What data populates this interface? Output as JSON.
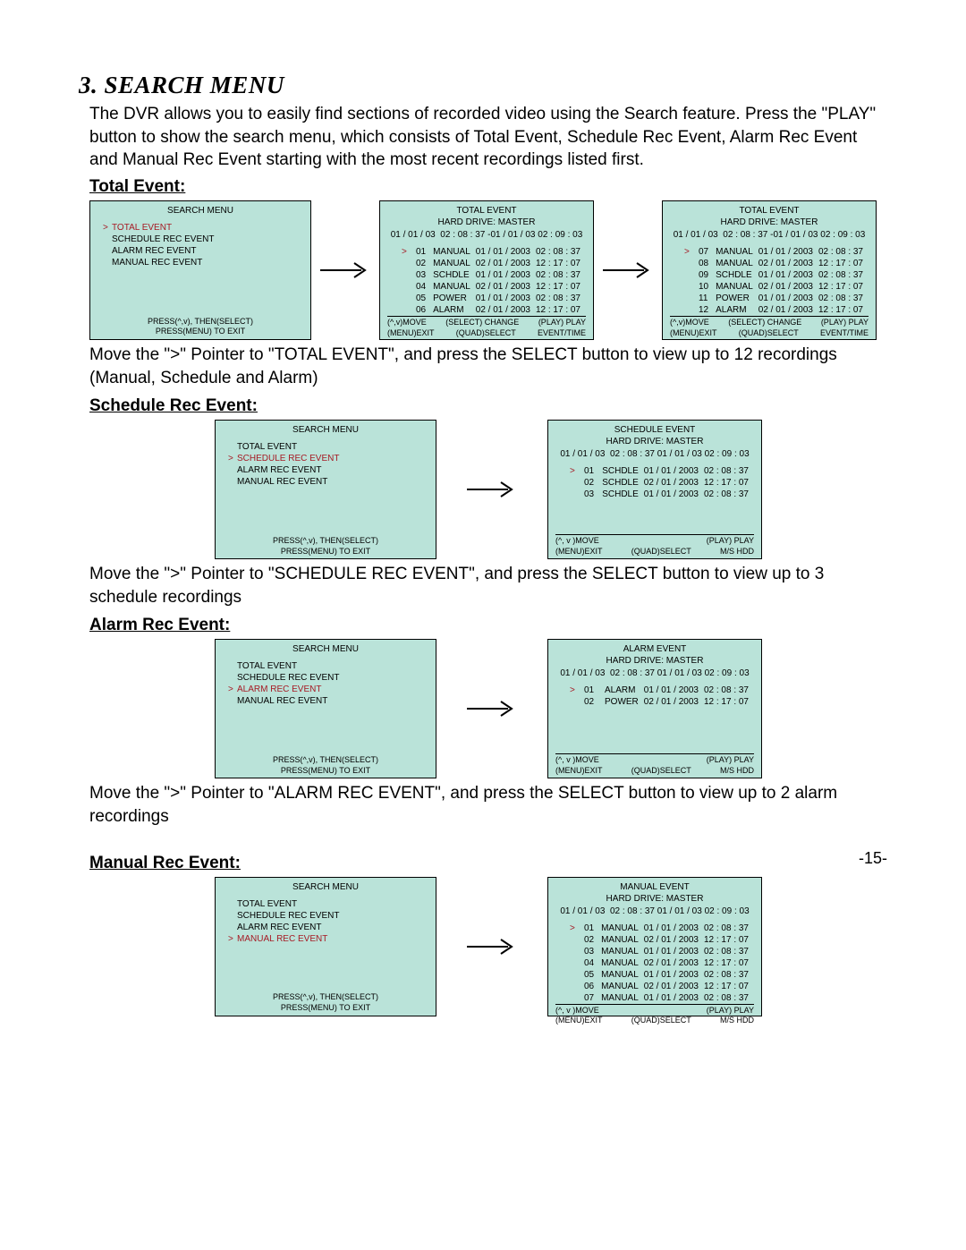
{
  "page_number": "-15-",
  "title": "3. SEARCH MENU",
  "intro": "The DVR allows you to easily find sections of recorded video using the Search feature. Press the \"PLAY\" button to show the search menu, which consists of Total Event, Schedule Rec Event, Alarm Rec Event and Manual Rec Event starting with the most recent recordings listed first.",
  "sections": {
    "total": {
      "heading": "Total Event:",
      "desc": "Move the \">\" Pointer to \"TOTAL EVENT\", and press the SELECT button to view up to 12 recordings (Manual, Schedule and Alarm)"
    },
    "schedule": {
      "heading": "Schedule Rec Event:",
      "desc": "Move the \">\" Pointer to \"SCHEDULE REC EVENT\", and press the SELECT button to view up to 3 schedule recordings"
    },
    "alarm": {
      "heading": "Alarm Rec Event:",
      "desc": "Move the \">\" Pointer to \"ALARM REC EVENT\", and press the SELECT button to view up to 2 alarm recordings"
    },
    "manual": {
      "heading": "Manual Rec Event:"
    }
  },
  "menu_screen": {
    "title": "SEARCH MENU",
    "items": [
      "TOTAL EVENT",
      "SCHEDULE REC EVENT",
      "ALARM REC EVENT",
      "MANUAL REC EVENT"
    ],
    "hint1": "PRESS(^,v), THEN(SELECT)",
    "hint2": "PRESS(MENU) TO EXIT"
  },
  "range": {
    "date1": "01 / 01 / 03",
    "span": "02 : 08 : 37 -01 / 01 / 03 02 : 09 : 03",
    "span2": "02 : 08 : 37  01 / 01 / 03 02 : 09 : 03"
  },
  "hard_drive": "HARD DRIVE:  MASTER",
  "footer": {
    "a": "(^,v)MOVE",
    "b": "(SELECT) CHANGE",
    "c": "(PLAY) PLAY",
    "d": "(MENU)EXIT",
    "e": "(QUAD)SELECT",
    "f": "EVENT/TIME",
    "g": "M/S HDD",
    "a2": "(^, v )MOVE"
  },
  "total_event": {
    "title": "TOTAL EVENT",
    "rows1": [
      [
        "01",
        "MANUAL",
        "01 / 01 / 2003",
        "02 : 08 : 37"
      ],
      [
        "02",
        "MANUAL",
        "02 / 01 / 2003",
        "12 : 17 : 07"
      ],
      [
        "03",
        "SCHDLE",
        "01 / 01 / 2003",
        "02 : 08 : 37"
      ],
      [
        "04",
        "MANUAL",
        "02 / 01 / 2003",
        "12 : 17 : 07"
      ],
      [
        "05",
        "POWER",
        "01 / 01 / 2003",
        "02 : 08 : 37"
      ],
      [
        "06",
        "ALARM",
        "02 / 01 / 2003",
        "12 : 17 : 07"
      ]
    ],
    "rows2": [
      [
        "07",
        "MANUAL",
        "01 / 01 / 2003",
        "02 : 08 : 37"
      ],
      [
        "08",
        "MANUAL",
        "02 / 01 / 2003",
        "12 : 17 : 07"
      ],
      [
        "09",
        "SCHDLE",
        "01 / 01 / 2003",
        "02 : 08 : 37"
      ],
      [
        "10",
        "MANUAL",
        "02 / 01 / 2003",
        "12 : 17 : 07"
      ],
      [
        "11",
        "POWER",
        "01 / 01 / 2003",
        "02 : 08 : 37"
      ],
      [
        "12",
        "ALARM",
        "02 / 01 / 2003",
        "12 : 17 : 07"
      ]
    ]
  },
  "schedule_event": {
    "title": "SCHEDULE EVENT",
    "rows": [
      [
        "01",
        "SCHDLE",
        "01 / 01 / 2003",
        "02 : 08 : 37"
      ],
      [
        "02",
        "SCHDLE",
        "02 / 01 / 2003",
        "12 : 17 : 07"
      ],
      [
        "03",
        "SCHDLE",
        "01 / 01 / 2003",
        "02 : 08 : 37"
      ]
    ]
  },
  "alarm_event": {
    "title": "ALARM EVENT",
    "rows": [
      [
        "01",
        "ALARM",
        "01 / 01 / 2003",
        "02 : 08 : 37"
      ],
      [
        "02",
        "POWER",
        "02 / 01 / 2003",
        "12 : 17 : 07"
      ]
    ]
  },
  "manual_event": {
    "title": "MANUAL EVENT",
    "rows": [
      [
        "01",
        "MANUAL",
        "01 / 01 / 2003",
        "02 : 08 : 37"
      ],
      [
        "02",
        "MANUAL",
        "02 / 01 / 2003",
        "12 : 17 : 07"
      ],
      [
        "03",
        "MANUAL",
        "01 / 01 / 2003",
        "02 : 08 : 37"
      ],
      [
        "04",
        "MANUAL",
        "02 / 01 / 2003",
        "12 : 17 : 07"
      ],
      [
        "05",
        "MANUAL",
        "01 / 01 / 2003",
        "02 : 08 : 37"
      ],
      [
        "06",
        "MANUAL",
        "02 / 01 / 2003",
        "12 : 17 : 07"
      ],
      [
        "07",
        "MANUAL",
        "01 / 01 / 2003",
        "02 : 08 : 37"
      ]
    ]
  }
}
